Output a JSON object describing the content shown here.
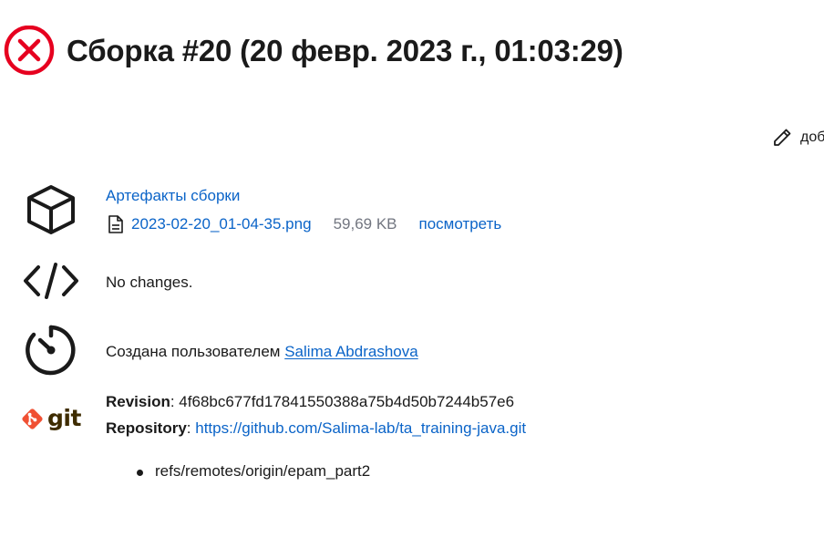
{
  "header": {
    "title": "Сборка #20 (20 февр. 2023 г., 01:03:29)",
    "status_icon": "failed-x-icon",
    "status_color": "#e6001f"
  },
  "actions": {
    "edit_description_label": "доб",
    "edit_icon": "pencil-icon"
  },
  "artifacts": {
    "title": "Артефакты сборки",
    "icon": "package-box-icon",
    "file_icon": "document-icon",
    "items": [
      {
        "name": "2023-02-20_01-04-35.png",
        "size": "59,69 KB",
        "view_label": "посмотреть"
      }
    ]
  },
  "changes": {
    "icon": "code-brackets-icon",
    "text": "No changes."
  },
  "cause": {
    "icon": "timer-icon",
    "prefix": "Создана пользователем ",
    "user": "Salima Abdrashova"
  },
  "git": {
    "icon": "git-logo-icon",
    "logo_text": "git",
    "revision_label": "Revision",
    "revision_value": ": 4f68bc677fd17841550388a75b4d50b7244b57e6",
    "repository_label": "Repository",
    "repository_sep": ": ",
    "repository_url": "https://github.com/Salima-lab/ta_training-java.git",
    "branches": [
      "refs/remotes/origin/epam_part2"
    ]
  },
  "colors": {
    "link": "#0b64c8",
    "muted": "#727680",
    "text": "#1a1a1a",
    "git_orange": "#f05033"
  }
}
